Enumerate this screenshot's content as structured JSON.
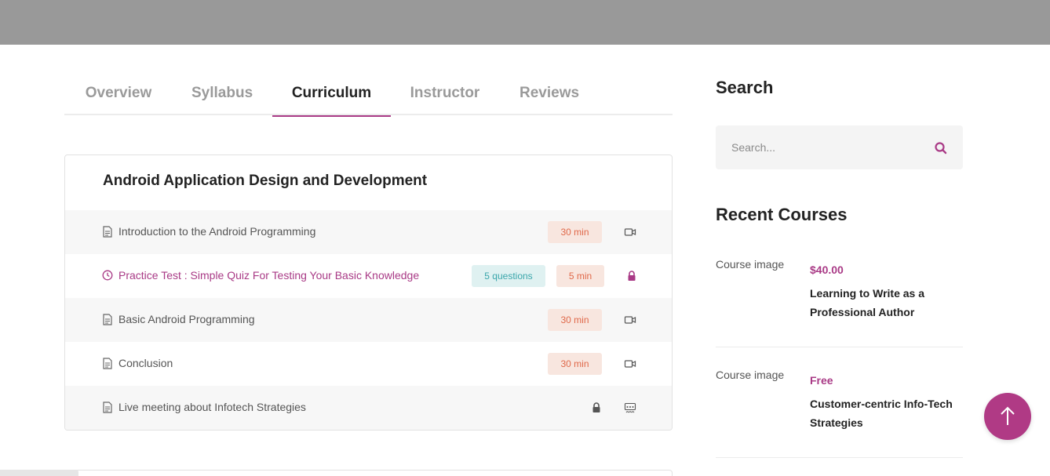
{
  "tabs": [
    {
      "label": "Overview"
    },
    {
      "label": "Syllabus"
    },
    {
      "label": "Curriculum"
    },
    {
      "label": "Instructor"
    },
    {
      "label": "Reviews"
    }
  ],
  "active_tab": "Curriculum",
  "curriculum": {
    "section_title": "Android Application Design and Development",
    "lessons": [
      {
        "title": "Introduction to the Android Programming",
        "icon": "document-icon",
        "duration": "30 min",
        "meta_icon": "video-icon"
      },
      {
        "title": "Practice Test : Simple Quiz For Testing Your Basic Knowledge",
        "icon": "clock-icon",
        "questions": "5 questions",
        "duration": "5 min",
        "meta_icon": "lock-icon"
      },
      {
        "title": "Basic Android Programming",
        "icon": "document-icon",
        "duration": "30 min",
        "meta_icon": "video-icon"
      },
      {
        "title": "Conclusion",
        "icon": "document-icon",
        "duration": "30 min",
        "meta_icon": "video-icon"
      },
      {
        "title": "Live meeting about Infotech Strategies",
        "icon": "document-icon",
        "meta_icons": [
          "lock-icon",
          "meeting-icon"
        ]
      }
    ]
  },
  "sidebar": {
    "search_heading": "Search",
    "search_placeholder": "Search...",
    "recent_heading": "Recent Courses",
    "courses": [
      {
        "image_alt": "Course image",
        "price": "$40.00",
        "title": "Learning to Write as a Professional Author"
      },
      {
        "image_alt": "Course image",
        "price": "Free",
        "title": "Customer-centric Info-Tech Strategies"
      }
    ]
  },
  "colors": {
    "accent": "#a93a86",
    "topbar": "#999999",
    "duration_badge_bg": "#f8e6df",
    "duration_badge_text": "#e0694a",
    "questions_badge_bg": "#dff1f1",
    "questions_badge_text": "#3aa6ab"
  },
  "icons": {
    "search": "search-icon",
    "scroll_top": "arrow-up-icon"
  }
}
